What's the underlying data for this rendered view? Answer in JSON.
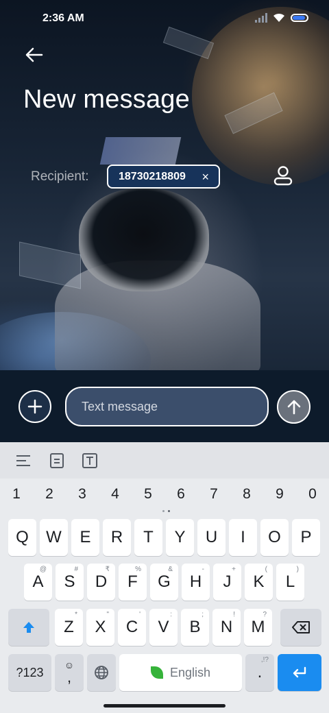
{
  "status_bar": {
    "time": "2:36 AM",
    "battery_level": 0.9
  },
  "header": {
    "title": "New message"
  },
  "recipient": {
    "label": "Recipient:",
    "chip_text": "18730218809",
    "chip_close": "×"
  },
  "compose": {
    "placeholder": "Text message"
  },
  "keyboard": {
    "numbers": [
      "1",
      "2",
      "3",
      "4",
      "5",
      "6",
      "7",
      "8",
      "9",
      "0"
    ],
    "row1": [
      "Q",
      "W",
      "E",
      "R",
      "T",
      "Y",
      "U",
      "I",
      "O",
      "P"
    ],
    "row2": [
      {
        "k": "A",
        "h": "@"
      },
      {
        "k": "S",
        "h": "#"
      },
      {
        "k": "D",
        "h": "₹"
      },
      {
        "k": "F",
        "h": "%"
      },
      {
        "k": "G",
        "h": "&"
      },
      {
        "k": "H",
        "h": "-"
      },
      {
        "k": "J",
        "h": "+"
      },
      {
        "k": "K",
        "h": "("
      },
      {
        "k": "L",
        "h": ")"
      }
    ],
    "row3": [
      {
        "k": "Z",
        "h": "*"
      },
      {
        "k": "X",
        "h": "\""
      },
      {
        "k": "C",
        "h": "'"
      },
      {
        "k": "V",
        "h": ":"
      },
      {
        "k": "B",
        "h": ";"
      },
      {
        "k": "N",
        "h": "!"
      },
      {
        "k": "M",
        "h": "?"
      }
    ],
    "symbols_label": "?123",
    "comma_label": ",",
    "space_label": "English",
    "period_label": ".",
    "period_hint": ",!?"
  },
  "colors": {
    "accent": "#1a8cf0",
    "chip_bg": "#17335a",
    "compose_bg": "#0d1b2b"
  }
}
